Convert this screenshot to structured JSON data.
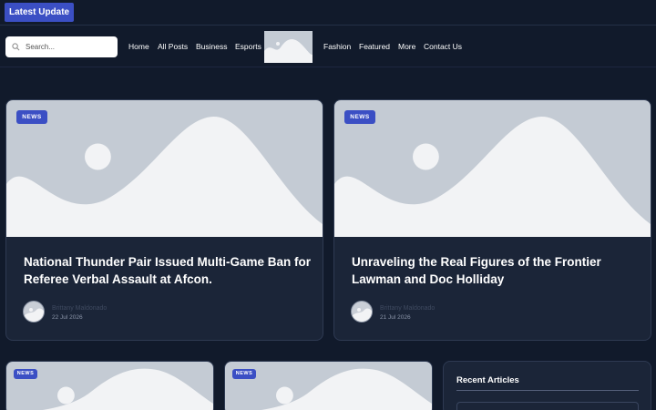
{
  "topbar": {
    "latest_label": "Latest  Update"
  },
  "search": {
    "placeholder": "Search..."
  },
  "nav": {
    "items": [
      "Home",
      "All Posts",
      "Business",
      "Esports",
      "Fashion",
      "Featured",
      "More",
      "Contact Us"
    ]
  },
  "featured": [
    {
      "badge": "NEWS",
      "title": "National Thunder Pair Issued Multi-Game Ban for Referee Verbal Assault at Afcon.",
      "author": "Brittany Maldonado",
      "date": "22 Jul 2026"
    },
    {
      "badge": "NEWS",
      "title": "Unraveling the Real Figures of the Frontier Lawman and Doc Holliday",
      "author": "Brittany Maldonado",
      "date": "21 Jul 2026"
    }
  ],
  "secondary": [
    {
      "badge": "NEWS"
    },
    {
      "badge": "NEWS"
    }
  ],
  "sidebar": {
    "title": "Recent Articles"
  },
  "colors": {
    "background": "#111a2b",
    "card": "#1b2538",
    "accent": "#3b4fc4",
    "placeholder_bg": "#c4cbd4",
    "placeholder_shape": "#f2f3f5"
  }
}
